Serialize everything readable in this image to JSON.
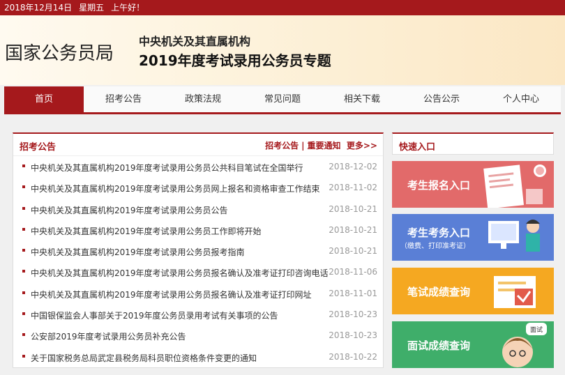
{
  "topbar": {
    "date": "2018年12月14日",
    "weekday": "星期五",
    "greeting": "上午好！"
  },
  "banner": {
    "org": "国家公务员局",
    "subtitle1": "中央机关及其直属机构",
    "subtitle2": "2019年度考试录用公务员专题"
  },
  "nav": {
    "items": [
      "首页",
      "招考公告",
      "政策法规",
      "常见问题",
      "相关下载",
      "公告公示",
      "个人中心"
    ]
  },
  "news": {
    "title": "招考公告",
    "link1": "招考公告",
    "separator": "|",
    "link2": "重要通知",
    "more": "更多>>",
    "items": [
      {
        "text": "中央机关及其直属机构2019年度考试录用公务员公共科目笔试在全国举行",
        "date": "2018-12-02"
      },
      {
        "text": "中央机关及其直属机构2019年度考试录用公务员网上报名和资格审查工作结束",
        "date": "2018-11-02"
      },
      {
        "text": "中央机关及其直属机构2019年度考试录用公务员公告",
        "date": "2018-10-21"
      },
      {
        "text": "中央机关及其直属机构2019年度考试录用公务员工作即将开始",
        "date": "2018-10-21"
      },
      {
        "text": "中央机关及其直属机构2019年度考试录用公务员报考指南",
        "date": "2018-10-21"
      },
      {
        "text": "中央机关及其直属机构2019年度考试录用公务员报名确认及准考证打印咨询电话",
        "date": "2018-11-06"
      },
      {
        "text": "中央机关及其直属机构2019年度考试录用公务员报名确认及准考证打印网址",
        "date": "2018-11-01"
      },
      {
        "text": "中国银保监会人事部关于2019年度公务员录用考试有关事项的公告",
        "date": "2018-10-23"
      },
      {
        "text": "公安部2019年度考试录用公务员补充公告",
        "date": "2018-10-23"
      },
      {
        "text": "关于国家税务总局武定县税务局科员职位资格条件变更的通知",
        "date": "2018-10-22"
      }
    ]
  },
  "quick": {
    "title": "快速入口",
    "btn1": "考生报名入口",
    "btn2": "考生考务入口",
    "btn2_sub": "（缴费、打印准考证）",
    "btn3": "笔试成绩查询",
    "btn4": "面试成绩查询",
    "btn4_bubble": "面试"
  },
  "colors": {
    "brand": "#a5191c",
    "btn1": "#e26a6a",
    "btn2": "#5a7fd6",
    "btn3": "#f5a821",
    "btn4": "#3fae6a"
  }
}
